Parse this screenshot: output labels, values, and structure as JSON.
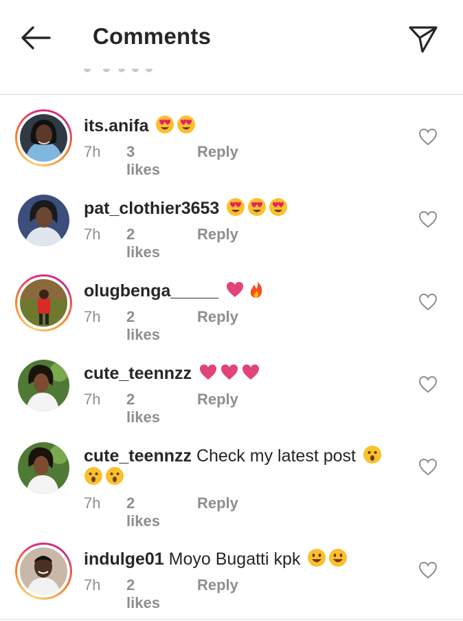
{
  "header": {
    "title": "Comments"
  },
  "comments": [
    {
      "username": "its.anifa",
      "text": "",
      "time": "7h",
      "likes": "3 likes",
      "reply": "Reply"
    },
    {
      "username": "pat_clothier3653",
      "text": "",
      "time": "7h",
      "likes": "2 likes",
      "reply": "Reply"
    },
    {
      "username": "olugbenga_____",
      "text": "",
      "time": "7h",
      "likes": "2 likes",
      "reply": "Reply"
    },
    {
      "username": "cute_teennzz",
      "text": "",
      "time": "7h",
      "likes": "2 likes",
      "reply": "Reply"
    },
    {
      "username": "cute_teennzz",
      "text": "Check my latest post",
      "time": "7h",
      "likes": "2 likes",
      "reply": "Reply"
    },
    {
      "username": "indulge01",
      "text": "Moyo Bugatti kpk",
      "time": "7h",
      "likes": "2 likes",
      "reply": "Reply"
    }
  ],
  "icons": {
    "back": "arrow-left-icon",
    "send": "paper-plane-icon",
    "like": "heart-outline-icon"
  },
  "colors": {
    "text": "#262626",
    "meta": "#8e8e8e",
    "divider": "#dbdbdb",
    "story_ring": "#dd2a7b"
  }
}
